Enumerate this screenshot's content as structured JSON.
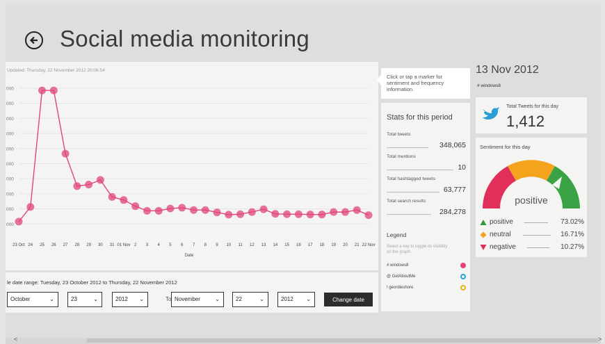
{
  "header": {
    "title": "Social media monitoring"
  },
  "chart": {
    "updated": "Updated: Thursday, 22 November 2012 20:06:54",
    "xlabel": "Date",
    "ytick_labels": [
      "000",
      "000",
      "000",
      "000",
      "000",
      "000",
      "000",
      "000",
      "000",
      "000"
    ]
  },
  "chart_data": {
    "type": "line",
    "title": "",
    "xlabel": "Date",
    "ylabel": "",
    "categories": [
      "23 Oct",
      "24",
      "25",
      "26",
      "27",
      "28",
      "29",
      "30",
      "31",
      "01 Nov",
      "2",
      "3",
      "4",
      "5",
      "6",
      "7",
      "8",
      "9",
      "10",
      "11",
      "12",
      "13",
      "14",
      "15",
      "16",
      "17",
      "18",
      "19",
      "20",
      "21",
      "22 Nov"
    ],
    "x_tick_labels": [
      "23 Oct",
      "24",
      "25",
      "26",
      "27",
      "28",
      "29",
      "30",
      "31",
      "01 Nov",
      "2",
      "3",
      "4",
      "5",
      "6",
      "7",
      "8",
      "9",
      "10",
      "11",
      "12",
      "13",
      "14",
      "15",
      "16",
      "17",
      "18",
      "19",
      "20",
      "21",
      "22 Nov"
    ],
    "series": [
      {
        "name": "# windows8",
        "color": "#e0457a",
        "values": [
          0.5,
          1.45,
          9.0,
          9.0,
          4.9,
          2.8,
          2.9,
          3.2,
          2.1,
          1.9,
          1.5,
          1.2,
          1.2,
          1.35,
          1.4,
          1.25,
          1.25,
          1.1,
          0.95,
          0.98,
          1.12,
          1.3,
          1.0,
          0.98,
          0.98,
          0.96,
          0.96,
          1.12,
          1.12,
          1.25,
          0.92
        ]
      }
    ],
    "ylim": [
      0,
      9.5
    ],
    "grid": true,
    "legend": "none"
  },
  "date_range": {
    "text": "le date range: Tuesday, 23 October 2012 to Thursday, 22 November 2012",
    "from_month": "October",
    "from_day": "23",
    "from_year": "2012",
    "to_label": "To:",
    "to_month": "November",
    "to_day": "22",
    "to_year": "2012",
    "change_button": "Change date"
  },
  "tooltip": {
    "text": "Click or tap a marker for sentiment and frequency information."
  },
  "stats": {
    "title": "Stats for this period",
    "items": [
      {
        "label": "Total tweets",
        "value": "348,065"
      },
      {
        "label": "Total mentions",
        "value": "10"
      },
      {
        "label": "Total hashtagged tweets",
        "value": "63,777"
      },
      {
        "label": "Total search results",
        "value": "284,278"
      }
    ],
    "legend_title": "Legend",
    "legend_hint": "Select a key to toggle its visibility on the graph.",
    "legend_items": [
      {
        "label": "# windows8",
        "color": "#e0457a",
        "filled": true
      },
      {
        "label": "@ GetAboutMe",
        "color": "#2a9fd6",
        "filled": false
      },
      {
        "label": "! geordieshore",
        "color": "#e8b31f",
        "filled": false
      }
    ]
  },
  "day": {
    "date": "13 Nov 2012",
    "hashtag": "#   windows8",
    "tweets_label": "Total Tweets for this day",
    "tweets_count": "1,412",
    "sentiment_label": "Sentiment for this day",
    "gauge_text": "positive",
    "gauge_colors": [
      "#e0305a",
      "#f3a41c",
      "#3aa345"
    ],
    "sentiments": [
      {
        "name": "positive",
        "pct": "73.02%",
        "color": "#2f9a3e",
        "marker": "up-triangle"
      },
      {
        "name": "neutral",
        "pct": "16.71%",
        "color": "#f0a21b",
        "marker": "diamond"
      },
      {
        "name": "negative",
        "pct": "10.27%",
        "color": "#e0305a",
        "marker": "down-triangle"
      }
    ]
  },
  "scroll": {
    "left": "<",
    "right": ">"
  }
}
